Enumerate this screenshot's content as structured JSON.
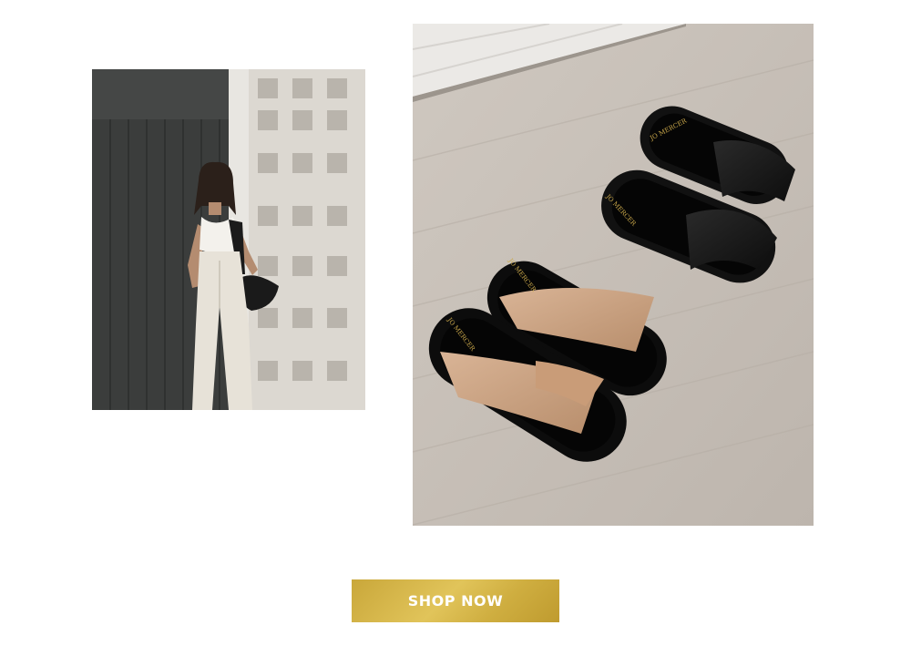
{
  "lifestyle_image": {
    "alt": "Woman in white outfit wearing black slides against breeze-block wall"
  },
  "product_image": {
    "alt": "Two pairs of twisted slide sandals, tan and black",
    "brand_marks": [
      "JO MERCER",
      "JO MERCER",
      "JO MERCER",
      "JO MERCER"
    ]
  },
  "cta": {
    "label": "SHOP NOW"
  },
  "colors": {
    "button_gold": "#d4b548",
    "tan_leather": "#c8a080",
    "black_leather": "#111111",
    "floor": "#c9c2ba"
  }
}
